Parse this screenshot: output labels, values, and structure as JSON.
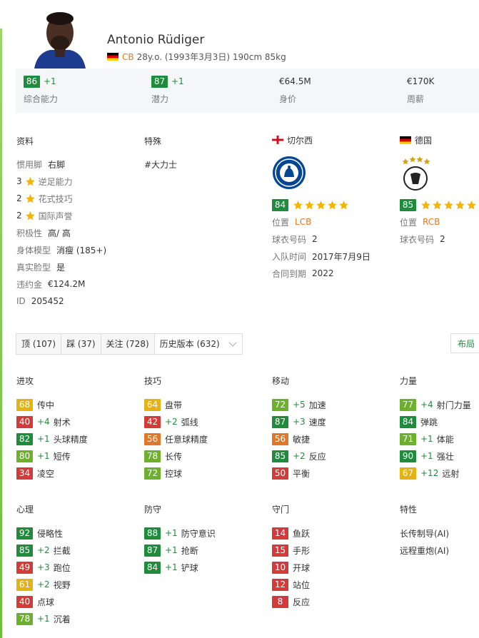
{
  "player": {
    "name": "Antonio Rüdiger",
    "position": "CB",
    "details": "28y.o. (1993年3月3日) 190cm 85kg"
  },
  "summary": [
    {
      "value": "86",
      "plus": "+1",
      "label": "综合能力"
    },
    {
      "value": "87",
      "plus": "+1",
      "label": "潜力"
    },
    {
      "text": "€64.5M",
      "label": "身价"
    },
    {
      "text": "€170K",
      "label": "周薪"
    }
  ],
  "info": {
    "title": "资料",
    "preferred_foot_label": "惯用脚",
    "preferred_foot": "右脚",
    "weak_foot_value": "3",
    "weak_foot_label": "逆足能力",
    "skill_moves_value": "2",
    "skill_moves_label": "花式技巧",
    "reputation_value": "2",
    "reputation_label": "国际声誉",
    "work_rate_label": "积极性",
    "work_rate": "高/ 高",
    "body_type_label": "身体模型",
    "body_type": "消瘦 (185+)",
    "real_face_label": "真实脸型",
    "real_face": "是",
    "release_label": "违约金",
    "release": "€124.2M",
    "id_label": "ID",
    "id": "205452"
  },
  "specialities": {
    "title": "特殊",
    "items": [
      "#大力士"
    ]
  },
  "club": {
    "name": "切尔西",
    "rating": "84",
    "pos_label": "位置",
    "pos": "LCB",
    "kit_label": "球衣号码",
    "kit": "2",
    "joined_label": "入队时间",
    "joined": "2017年7月9日",
    "contract_label": "合同到期",
    "contract": "2022"
  },
  "national": {
    "name": "德国",
    "rating": "85",
    "pos_label": "位置",
    "pos": "RCB",
    "kit_label": "球衣号码",
    "kit": "2"
  },
  "tabs": [
    "顶 (107)",
    "踩 (37)",
    "关注 (728)",
    "历史版本 (632)"
  ],
  "layout_button": "布局",
  "colors": {
    "dark_green": "#1f8b3d",
    "light_green": "#6eb02c",
    "yellow": "#e4b312",
    "orange": "#e0782a",
    "red": "#d33a3a",
    "star": "#f5b400"
  },
  "attribute_groups": [
    {
      "title": "进攻",
      "items": [
        {
          "v": "68",
          "c": "y",
          "inc": "",
          "n": "传中"
        },
        {
          "v": "40",
          "c": "r",
          "inc": "+4",
          "n": "射术"
        },
        {
          "v": "82",
          "c": "dg",
          "inc": "+1",
          "n": "头球精度"
        },
        {
          "v": "80",
          "c": "lg",
          "inc": "+1",
          "n": "短传"
        },
        {
          "v": "34",
          "c": "r",
          "inc": "",
          "n": "凌空"
        }
      ]
    },
    {
      "title": "技巧",
      "items": [
        {
          "v": "64",
          "c": "y",
          "inc": "",
          "n": "盘带"
        },
        {
          "v": "42",
          "c": "r",
          "inc": "+2",
          "n": "弧线"
        },
        {
          "v": "56",
          "c": "o",
          "inc": "",
          "n": "任意球精度"
        },
        {
          "v": "78",
          "c": "lg",
          "inc": "",
          "n": "长传"
        },
        {
          "v": "72",
          "c": "lg",
          "inc": "",
          "n": "控球"
        }
      ]
    },
    {
      "title": "移动",
      "items": [
        {
          "v": "72",
          "c": "lg",
          "inc": "+5",
          "n": "加速"
        },
        {
          "v": "87",
          "c": "dg",
          "inc": "+3",
          "n": "速度"
        },
        {
          "v": "56",
          "c": "o",
          "inc": "",
          "n": "敏捷"
        },
        {
          "v": "85",
          "c": "dg",
          "inc": "+2",
          "n": "反应"
        },
        {
          "v": "50",
          "c": "r",
          "inc": "",
          "n": "平衡"
        }
      ]
    },
    {
      "title": "力量",
      "items": [
        {
          "v": "77",
          "c": "lg",
          "inc": "+4",
          "n": "射门力量"
        },
        {
          "v": "84",
          "c": "dg",
          "inc": "",
          "n": "弹跳"
        },
        {
          "v": "71",
          "c": "lg",
          "inc": "+1",
          "n": "体能"
        },
        {
          "v": "90",
          "c": "dg",
          "inc": "+1",
          "n": "强壮"
        },
        {
          "v": "67",
          "c": "y",
          "inc": "+12",
          "n": "远射"
        }
      ]
    },
    {
      "title": "心理",
      "items": [
        {
          "v": "92",
          "c": "dg",
          "inc": "",
          "n": "侵略性"
        },
        {
          "v": "85",
          "c": "dg",
          "inc": "+2",
          "n": "拦截"
        },
        {
          "v": "49",
          "c": "r",
          "inc": "+3",
          "n": "跑位"
        },
        {
          "v": "61",
          "c": "y",
          "inc": "+2",
          "n": "视野"
        },
        {
          "v": "40",
          "c": "r",
          "inc": "",
          "n": "点球"
        },
        {
          "v": "78",
          "c": "lg",
          "inc": "+1",
          "n": "沉着"
        }
      ]
    },
    {
      "title": "防守",
      "items": [
        {
          "v": "88",
          "c": "dg",
          "inc": "+1",
          "n": "防守意识"
        },
        {
          "v": "87",
          "c": "dg",
          "inc": "+1",
          "n": "抢断"
        },
        {
          "v": "84",
          "c": "dg",
          "inc": "+1",
          "n": "铲球"
        }
      ]
    },
    {
      "title": "守门",
      "items": [
        {
          "v": "14",
          "c": "r",
          "inc": "",
          "n": "鱼跃"
        },
        {
          "v": "15",
          "c": "r",
          "inc": "",
          "n": "手形"
        },
        {
          "v": "10",
          "c": "r",
          "inc": "",
          "n": "开球"
        },
        {
          "v": "12",
          "c": "r",
          "inc": "",
          "n": "站位"
        },
        {
          "v": "8",
          "c": "r",
          "inc": "",
          "n": "反应"
        }
      ]
    }
  ],
  "traits": {
    "title": "特性",
    "items": [
      "长传制导(AI)",
      "远程重炮(AI)"
    ]
  }
}
